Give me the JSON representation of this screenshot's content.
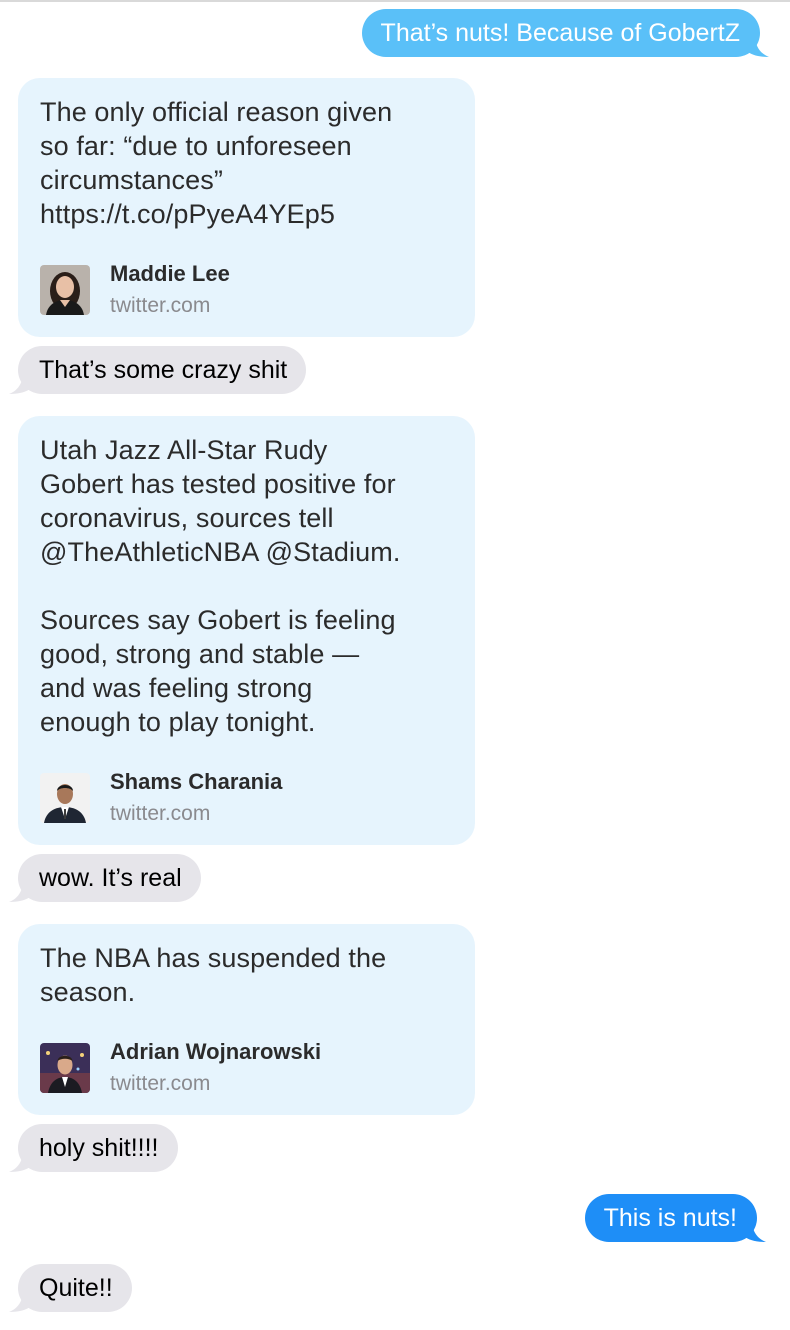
{
  "colors": {
    "outgoing_light": "#5ac0f8",
    "outgoing_dark": "#1e8ef7",
    "incoming": "#e6e5ea",
    "card_background": "#e6f4fd",
    "secondary_text": "#8a8a8e"
  },
  "messages": {
    "m1": "That’s nuts! Because of GobertZ",
    "m2": "That’s some crazy shit",
    "m3": "wow. It’s real",
    "m4": "holy shit!!!!",
    "m5": "This is nuts!",
    "m6": "Quite!!"
  },
  "cards": {
    "card1": {
      "text": "The only official reason given\nso far: “due to unforeseen\ncircumstances”\nhttps://t.co/pPyeA4YEp5",
      "author": "Maddie Lee",
      "domain": "twitter.com",
      "avatar_icon": "woman-portrait-avatar"
    },
    "card2": {
      "text": "Utah Jazz All-Star Rudy\nGobert has tested positive for\ncoronavirus, sources tell\n@TheAthleticNBA @Stadium.\n\nSources say Gobert is feeling\ngood, strong and stable —\nand was feeling strong\nenough to play tonight.",
      "author": "Shams Charania",
      "domain": "twitter.com",
      "avatar_icon": "man-in-suit-avatar"
    },
    "card3": {
      "text": "The NBA has suspended the\nseason.",
      "author": "Adrian Wojnarowski",
      "domain": "twitter.com",
      "avatar_icon": "man-studio-avatar"
    }
  }
}
